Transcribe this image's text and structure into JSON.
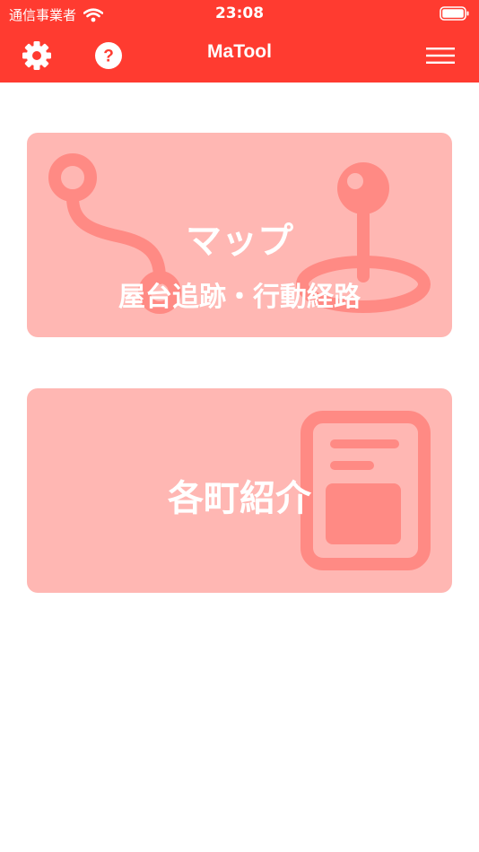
{
  "status_bar": {
    "carrier": "通信事業者",
    "time": "23:08"
  },
  "nav": {
    "title": "MaTool",
    "icons": [
      "gear-icon",
      "help-icon",
      "hamburger-menu-icon"
    ]
  },
  "cards": {
    "map": {
      "title": "マップ",
      "subtitle": "屋台追跡・行動経路",
      "icon": "route-pin-icon"
    },
    "towns": {
      "title": "各町紹介",
      "icon": "document-icon"
    }
  },
  "colors": {
    "accent": "#ff3b30",
    "card_bg": "#ffb7b3",
    "card_icon": "#ff8a84"
  }
}
